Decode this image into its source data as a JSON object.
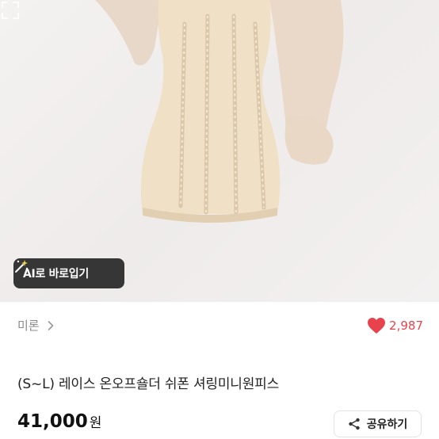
{
  "product_image": {
    "icon": "dress-photo"
  },
  "ai_button": {
    "label": "AI로 바로입기",
    "icon": "magic-wand-icon"
  },
  "expand": {
    "icon": "expand-icon"
  },
  "seller": {
    "name": "미론",
    "icon": "chevron-right-icon"
  },
  "likes": {
    "count": "2,987",
    "icon": "heart-icon",
    "color": "#e8424c"
  },
  "product": {
    "title": "(S~L) 레이스 온오프숄더 쉬폰 셔링미니원피스"
  },
  "price": {
    "amount": "41,000",
    "currency": "원"
  },
  "share_button": {
    "label": "공유하기",
    "icon": "share-icon"
  }
}
